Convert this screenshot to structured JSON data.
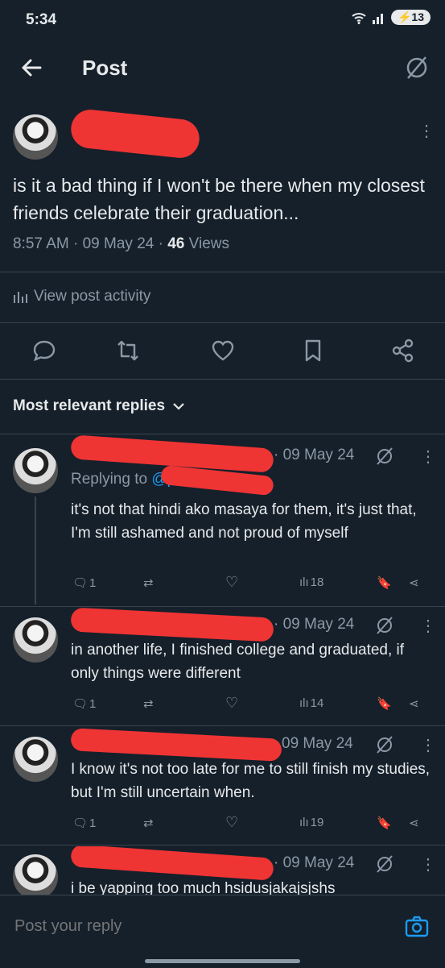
{
  "status_bar": {
    "time": "5:34",
    "battery": "13"
  },
  "header": {
    "title": "Post"
  },
  "post": {
    "text": "is it a bad thing if I won't be there when my closest friends celebrate their graduation...",
    "time": "8:57 AM",
    "date": "09 May 24",
    "views_count": "46",
    "views_label": "Views",
    "activity_label": "View post activity"
  },
  "replies_header": "Most relevant replies",
  "replies": [
    {
      "date": "09 May 24",
      "replying_prefix": "Replying to",
      "replying_handle": "@p",
      "text": "it's not that hindi ako masaya for them, it's just that, I'm still ashamed and not proud of myself",
      "replies": "1",
      "views": "18"
    },
    {
      "date": "09 May 24",
      "text": "in another life, I finished college and graduated, if only things were different",
      "replies": "1",
      "views": "14"
    },
    {
      "date": "09 May 24",
      "text": "I know it's not too late for me to still finish my studies, but I'm still uncertain when.",
      "replies": "1",
      "views": "19"
    },
    {
      "date": "09 May 24",
      "text": "i be yapping too much hsidusjakajsjshs"
    }
  ],
  "composer": {
    "placeholder": "Post your reply"
  },
  "colors": {
    "background": "#15202b",
    "text": "#e7e9ea",
    "muted": "#8b98a5",
    "accent": "#1d9bf0",
    "redaction": "#ef3434"
  }
}
